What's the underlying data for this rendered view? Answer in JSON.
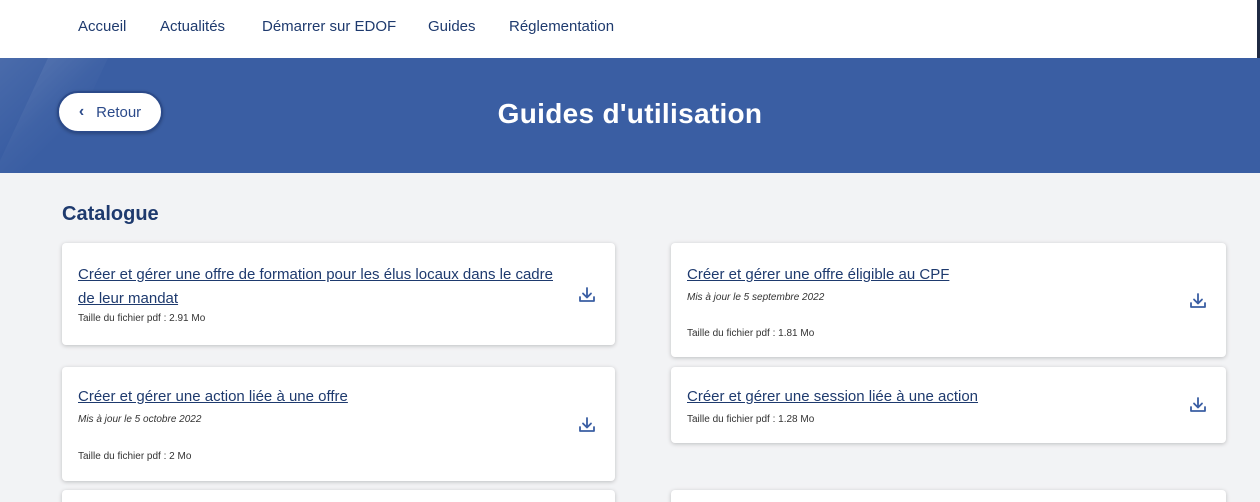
{
  "nav": {
    "items": [
      {
        "label": "Accueil"
      },
      {
        "label": "Actualités"
      },
      {
        "label": "Démarrer sur EDOF"
      },
      {
        "label": "Guides"
      },
      {
        "label": "Réglementation"
      }
    ]
  },
  "banner": {
    "back_label": "Retour",
    "title": "Guides d'utilisation",
    "color": "#3a5ea3"
  },
  "section": {
    "title": "Catalogue"
  },
  "cards": [
    {
      "title": "Créer et gérer une offre de formation pour les élus locaux dans le cadre de leur mandat",
      "date": "",
      "size": "Taille du fichier pdf : 2.91 Mo",
      "icon": "download-icon"
    },
    {
      "title": "Créer et gérer une offre éligible au CPF",
      "date": "Mis à jour le 5 septembre 2022",
      "size": "Taille du fichier pdf : 1.81 Mo",
      "icon": "download-icon"
    },
    {
      "title": "Créer et gérer une action liée à une offre",
      "date": "Mis à jour le 5 octobre 2022",
      "size": "Taille du fichier pdf : 2 Mo",
      "icon": "download-icon"
    },
    {
      "title": "Créer et gérer une session liée à une action",
      "date": "",
      "size": "Taille du fichier pdf : 1.28 Mo",
      "icon": "download-icon"
    }
  ],
  "colors": {
    "accent": "#1e3a6e",
    "background": "#f2f3f5"
  }
}
